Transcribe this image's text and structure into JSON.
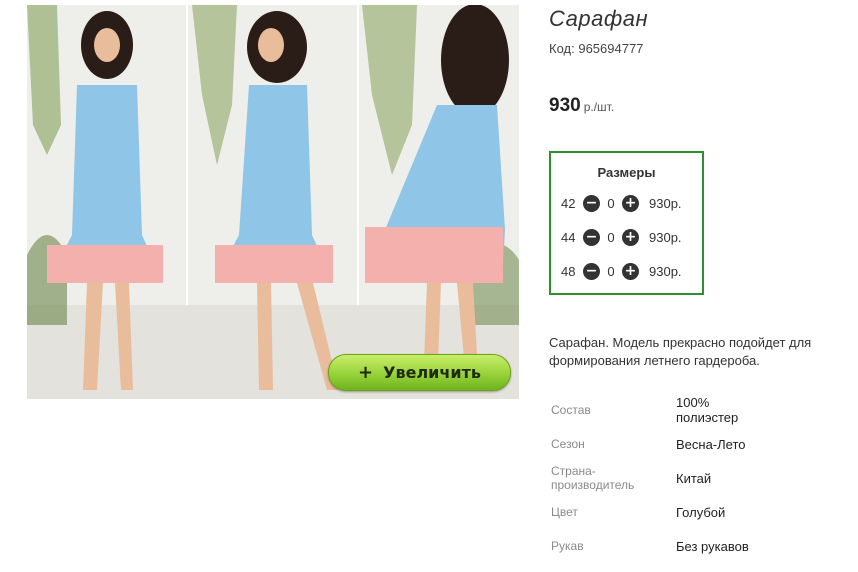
{
  "product": {
    "title": "Сарафан",
    "code_label": "Код:",
    "code": "965694777",
    "price": "930",
    "price_unit": "р./шт."
  },
  "zoom_button": {
    "icon": "plus-icon",
    "label": "Увеличить",
    "color": "#96d23a"
  },
  "sizes": {
    "title": "Размеры",
    "border_color": "#2f8f2f",
    "rows": [
      {
        "size": "42",
        "minus_icon": "minus-circle-icon",
        "quantity": "0",
        "plus_icon": "plus-circle-icon",
        "price": "930р."
      },
      {
        "size": "44",
        "minus_icon": "minus-circle-icon",
        "quantity": "0",
        "plus_icon": "plus-circle-icon",
        "price": "930р."
      },
      {
        "size": "48",
        "minus_icon": "minus-circle-icon",
        "quantity": "0",
        "plus_icon": "plus-circle-icon",
        "price": "930р."
      }
    ]
  },
  "description": "Сарафан. Модель прекрасно подойдет для формирования летнего гардероба.",
  "specs": [
    {
      "label": "Состав",
      "value": "100% полиэстер"
    },
    {
      "label": "Сезон",
      "value": "Весна-Лето"
    },
    {
      "label": "Страна-производитель",
      "value": "Китай"
    },
    {
      "label": "Цвет",
      "value": "Голубой"
    },
    {
      "label": "Рукав",
      "value": "Без рукавов"
    }
  ],
  "colors": {
    "dress": "#8fc6e8",
    "lace": "#f4b0ad",
    "frame": "#2f8f2f"
  }
}
